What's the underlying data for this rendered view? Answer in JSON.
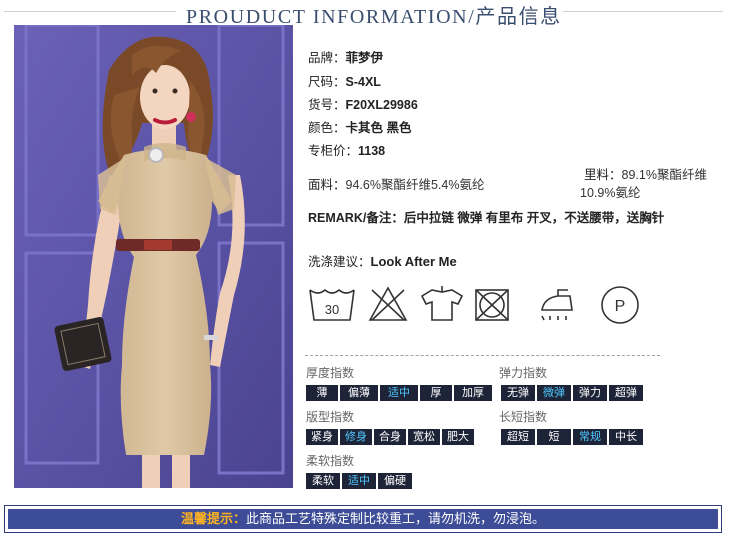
{
  "header": {
    "title": "PROUDUCT INFORMATION/产品信息"
  },
  "info": {
    "brand_label": "品牌：",
    "brand": "菲梦伊",
    "size_label": "尺码：",
    "size": "S-4XL",
    "sku_label": "货号：",
    "sku": "F20XL29986",
    "color_label": "颜色：",
    "color": "卡其色  黑色",
    "price_label": "专柜价：",
    "price": "1138",
    "fabric_label": "面料：",
    "fabric": "94.6%聚酯纤维5.4%氨纶",
    "lining_label": "里料：",
    "lining_line1": "89.1%聚酯纤维",
    "lining_line2": "10.9%氨纶",
    "remark_label": "REMARK/备注：",
    "remark": "后中拉链 微弹 有里布 开叉，不送腰带，送胸针",
    "wash_label": "洗涤建议：",
    "wash": "Look After Me"
  },
  "care_icons": [
    "wash-30-icon",
    "no-bleach-icon",
    "hang-dry-icon",
    "no-tumble-dry-icon",
    "iron-icon",
    "professional-clean-icon"
  ],
  "care_wash_temp": "30",
  "care_dryclean_letter": "P",
  "indices": {
    "thickness": {
      "title": "厚度指数",
      "options": [
        "薄",
        "偏薄",
        "适中",
        "厚",
        "加厚"
      ],
      "selected": "适中"
    },
    "elasticity": {
      "title": "弹力指数",
      "options": [
        "无弹",
        "微弹",
        "弹力",
        "超弹"
      ],
      "selected": "微弹"
    },
    "fit": {
      "title": "版型指数",
      "options": [
        "紧身",
        "修身",
        "合身",
        "宽松",
        "肥大"
      ],
      "selected": "修身"
    },
    "length": {
      "title": "长短指数",
      "options": [
        "超短",
        "短",
        "常规",
        "中长"
      ],
      "selected": "常规"
    },
    "softness": {
      "title": "柔软指数",
      "options": [
        "柔软",
        "适中",
        "偏硬"
      ],
      "selected": "适中"
    }
  },
  "banner": {
    "highlight": "温馨提示：",
    "text": "此商品工艺特殊定制比较重工，请勿机洗，勿浸泡。"
  },
  "colors": {
    "chip_bg": "#1e2438",
    "chip_selected": "#4fc8ff",
    "banner_bg": "#3d4c96",
    "banner_highlight": "#ffb320",
    "header_text": "#3a4e70",
    "backdrop": "#5a52a6",
    "dress": "#d8c09c"
  }
}
